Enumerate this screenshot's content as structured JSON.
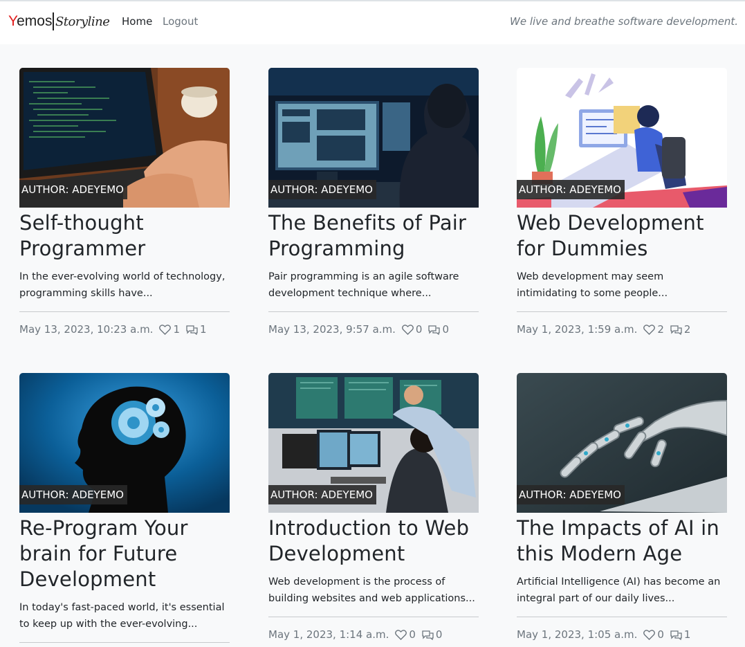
{
  "nav": {
    "brand_y": "Y",
    "brand_rest": "emos",
    "brand_script": "Storyline",
    "home": "Home",
    "logout": "Logout",
    "tagline": "We live and breathe software development."
  },
  "posts": [
    {
      "author": "AUTHOR: ADEYEMO",
      "title": "Self-thought Programmer",
      "excerpt": "In the ever-evolving world of technology, programming skills have...",
      "date": "May 13, 2023, 10:23 a.m.",
      "likes": "1",
      "comments": "1",
      "image": "laptop-coding-photo"
    },
    {
      "author": "AUTHOR: ADEYEMO",
      "title": "The Benefits of Pair Programming",
      "excerpt": "Pair programming is an agile software development technique where...",
      "date": "May 13, 2023, 9:57 a.m.",
      "likes": "0",
      "comments": "0",
      "image": "control-room-photo"
    },
    {
      "author": "AUTHOR: ADEYEMO",
      "title": "Web Development for Dummies",
      "excerpt": "Web development may seem intimidating to some people...",
      "date": "May 1, 2023, 1:59 a.m.",
      "likes": "2",
      "comments": "2",
      "image": "developer-illustration"
    },
    {
      "author": "AUTHOR: ADEYEMO",
      "title": "Re-Program Your brain for Future Development",
      "excerpt": "In today's fast-paced world, it's essential to keep up with the ever-evolving...",
      "date": "",
      "likes": "",
      "comments": "",
      "image": "brain-gears-silhouette"
    },
    {
      "author": "AUTHOR: ADEYEMO",
      "title": "Introduction to Web Development",
      "excerpt": "Web development is the process of building websites and web applications...",
      "date": "May 1, 2023, 1:14 a.m.",
      "likes": "0",
      "comments": "0",
      "image": "office-monitors-photo"
    },
    {
      "author": "AUTHOR: ADEYEMO",
      "title": "The Impacts of AI in this Modern Age",
      "excerpt": "Artificial Intelligence (AI) has become an integral part of our daily lives...",
      "date": "May 1, 2023, 1:05 a.m.",
      "likes": "0",
      "comments": "1",
      "image": "robot-hand-photo"
    }
  ],
  "colors": {
    "brand_accent": "#e11d1d",
    "muted": "#6c757d",
    "badge_bg": "#2b2b2b"
  }
}
